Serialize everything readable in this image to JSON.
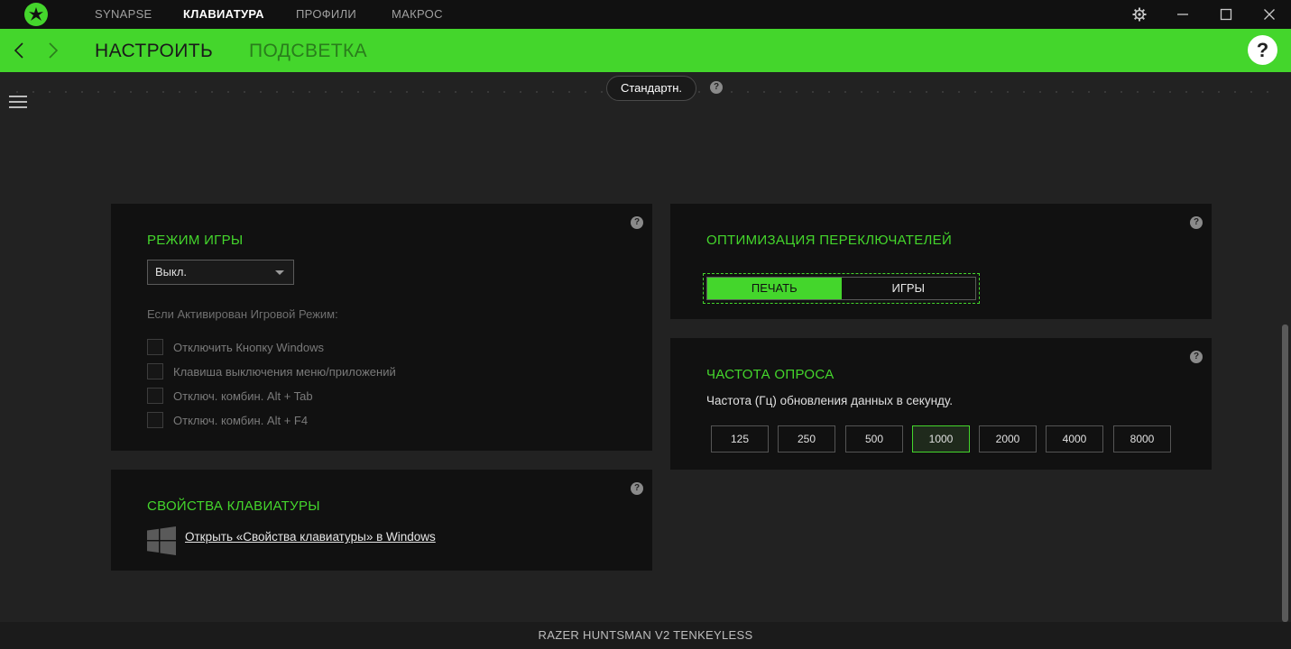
{
  "titlebar": {
    "tabs": [
      {
        "label": "SYNAPSE"
      },
      {
        "label": "КЛАВИАТУРА"
      },
      {
        "label": "ПРОФИЛИ"
      },
      {
        "label": "МАКРОС"
      }
    ],
    "active_tab": "КЛАВИАТУРА"
  },
  "header": {
    "subtabs": [
      {
        "label": "НАСТРОИТЬ"
      },
      {
        "label": "ПОДСВЕТКА"
      }
    ],
    "active_subtab": "НАСТРОИТЬ",
    "help": "?"
  },
  "profile": {
    "selected": "Стандартн.",
    "help": "?"
  },
  "game_mode": {
    "title": "РЕЖИМ ИГРЫ",
    "select_value": "Выкл.",
    "hint": "Если Активирован Игровой Режим:",
    "options": [
      {
        "label": "Отключить Кнопку Windows",
        "checked": false
      },
      {
        "label": "Клавиша выключения меню/приложений",
        "checked": false
      },
      {
        "label": "Отключ. комбин. Alt + Tab",
        "checked": false
      },
      {
        "label": "Отключ. комбин. Alt + F4",
        "checked": false
      }
    ],
    "help": "?"
  },
  "keyboard_props": {
    "title": "СВОЙСТВА КЛАВИАТУРЫ",
    "link": "Открыть «Свойства клавиатуры» в Windows",
    "help": "?"
  },
  "switch_opt": {
    "title": "ОПТИМИЗАЦИЯ ПЕРЕКЛЮЧАТЕЛЕЙ",
    "options": [
      "ПЕЧАТЬ",
      "ИГРЫ"
    ],
    "selected": "ПЕЧАТЬ",
    "help": "?"
  },
  "polling": {
    "title": "ЧАСТОТА ОПРОСА",
    "desc": "Частота (Гц) обновления данных в секунду.",
    "rates": [
      "125",
      "250",
      "500",
      "1000",
      "2000",
      "4000",
      "8000"
    ],
    "selected": "1000",
    "help": "?"
  },
  "status": {
    "device": "RAZER HUNTSMAN V2 TENKEYLESS"
  },
  "colors": {
    "accent": "#44d62c",
    "background": "#222222",
    "panel": "#111111"
  },
  "icons": [
    "razer-logo-icon",
    "gear-icon",
    "minimize-icon",
    "maximize-icon",
    "close-icon",
    "back-arrow-icon",
    "forward-arrow-icon",
    "hamburger-menu-icon",
    "help-icon",
    "windows-logo-icon",
    "dropdown-caret-icon"
  ]
}
